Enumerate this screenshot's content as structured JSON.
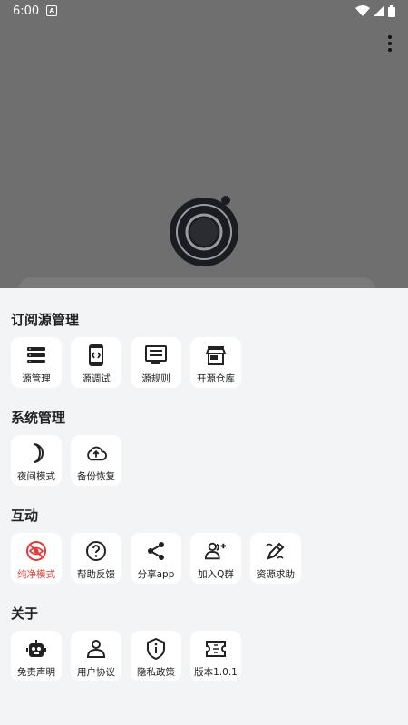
{
  "status": {
    "time": "6:00"
  },
  "sections": [
    {
      "title": "订阅源管理",
      "items": [
        "源管理",
        "源调试",
        "源规则",
        "开源仓库"
      ]
    },
    {
      "title": "系统管理",
      "items": [
        "夜间模式",
        "备份恢复"
      ]
    },
    {
      "title": "互动",
      "items": [
        "纯净模式",
        "帮助反馈",
        "分享app",
        "加入Q群",
        "资源求助"
      ]
    },
    {
      "title": "关于",
      "items": [
        "免责声明",
        "用户协议",
        "隐私政策",
        "版本1.0.1"
      ]
    }
  ],
  "colors": {
    "active": "#e53935",
    "sheet_bg": "#f3f4f6",
    "overlay": "#6f6f6f"
  }
}
